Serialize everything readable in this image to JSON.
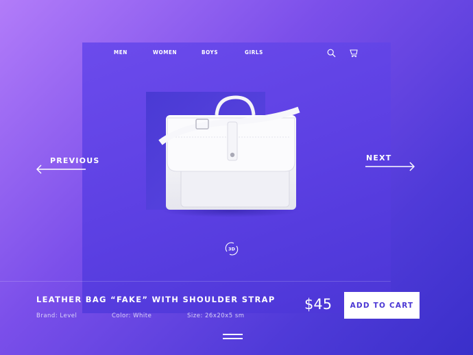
{
  "nav": {
    "items": [
      {
        "label": "MEN"
      },
      {
        "label": "WOMEN"
      },
      {
        "label": "BOYS"
      },
      {
        "label": "GIRLS"
      }
    ],
    "icons": [
      "search-icon",
      "cart-icon"
    ]
  },
  "carousel": {
    "previous_label": "PREVIOUS",
    "next_label": "NEXT",
    "view_3d_label": "3D"
  },
  "product": {
    "title": "LEATHER BAG “FAKE” WITH SHOULDER STRAP",
    "brand": "Brand: Level",
    "color": "Color: White",
    "size": "Size: 26x20x5 sm",
    "price": "$45",
    "add_to_cart_label": "ADD TO CART"
  },
  "colors": {
    "accent": "#4a37d4",
    "panel": "#5b3fe2"
  }
}
